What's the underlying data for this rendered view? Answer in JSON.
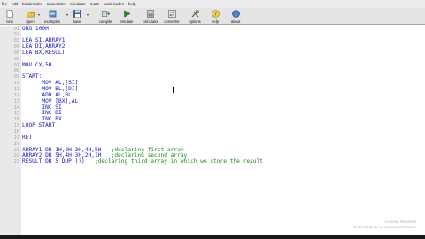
{
  "menu": [
    "file",
    "edit",
    "bookmarks",
    "assembler",
    "emulator",
    "math",
    "ascii codes",
    "help"
  ],
  "toolbar": {
    "new": "new",
    "open": "open",
    "examples": "examples",
    "save": "save",
    "compile": "compile",
    "emulate": "emulate",
    "calculator": "calculator",
    "convertor": "convertor",
    "options": "options",
    "help": "help",
    "about": "about"
  },
  "editor": {
    "line_numbers": [
      "01",
      "02",
      "03",
      "04",
      "05",
      "06",
      "07",
      "08",
      "09",
      "10",
      "11",
      "12",
      "13",
      "14",
      "15",
      "16",
      "17",
      "18",
      "19",
      "20",
      "21",
      "22",
      "23"
    ],
    "lines": [
      {
        "code": "ORG 100H",
        "comment": ""
      },
      {
        "code": "",
        "comment": ""
      },
      {
        "code": "LEA SI,ARRAY1",
        "comment": ""
      },
      {
        "code": "LEA DI,ARRAY2",
        "comment": ""
      },
      {
        "code": "LEA BX,RESULT",
        "comment": ""
      },
      {
        "code": "",
        "comment": ""
      },
      {
        "code": "MOV CX,5H",
        "comment": ""
      },
      {
        "code": "",
        "comment": ""
      },
      {
        "code": "START:",
        "comment": ""
      },
      {
        "code": "      MOV AL,[SI]",
        "comment": ""
      },
      {
        "code": "      MOV BL,[DI]",
        "comment": ""
      },
      {
        "code": "      ADD AL,BL",
        "comment": ""
      },
      {
        "code": "      MOV [BX],AL",
        "comment": ""
      },
      {
        "code": "      INC SI",
        "comment": ""
      },
      {
        "code": "      INC DI",
        "comment": ""
      },
      {
        "code": "      INC BX",
        "comment": ""
      },
      {
        "code": "LOOP START",
        "comment": ""
      },
      {
        "code": "",
        "comment": ""
      },
      {
        "code": "RET",
        "comment": ""
      },
      {
        "code": "",
        "comment": ""
      },
      {
        "code": "ARRAY1 DB 1H,2H,3H,4H,5H",
        "comment": ";declaring first array"
      },
      {
        "code": "ARRAY2 DB 5H,4H,3H,2H,1H",
        "comment": ";declaring second array"
      },
      {
        "code": "RESULT DB 5 DUP (?)",
        "comment": ";declaring third array in which we store the result"
      }
    ]
  },
  "watermark": {
    "line1": "Activate Windows",
    "line2": "Go to Settings to activate Windows."
  }
}
